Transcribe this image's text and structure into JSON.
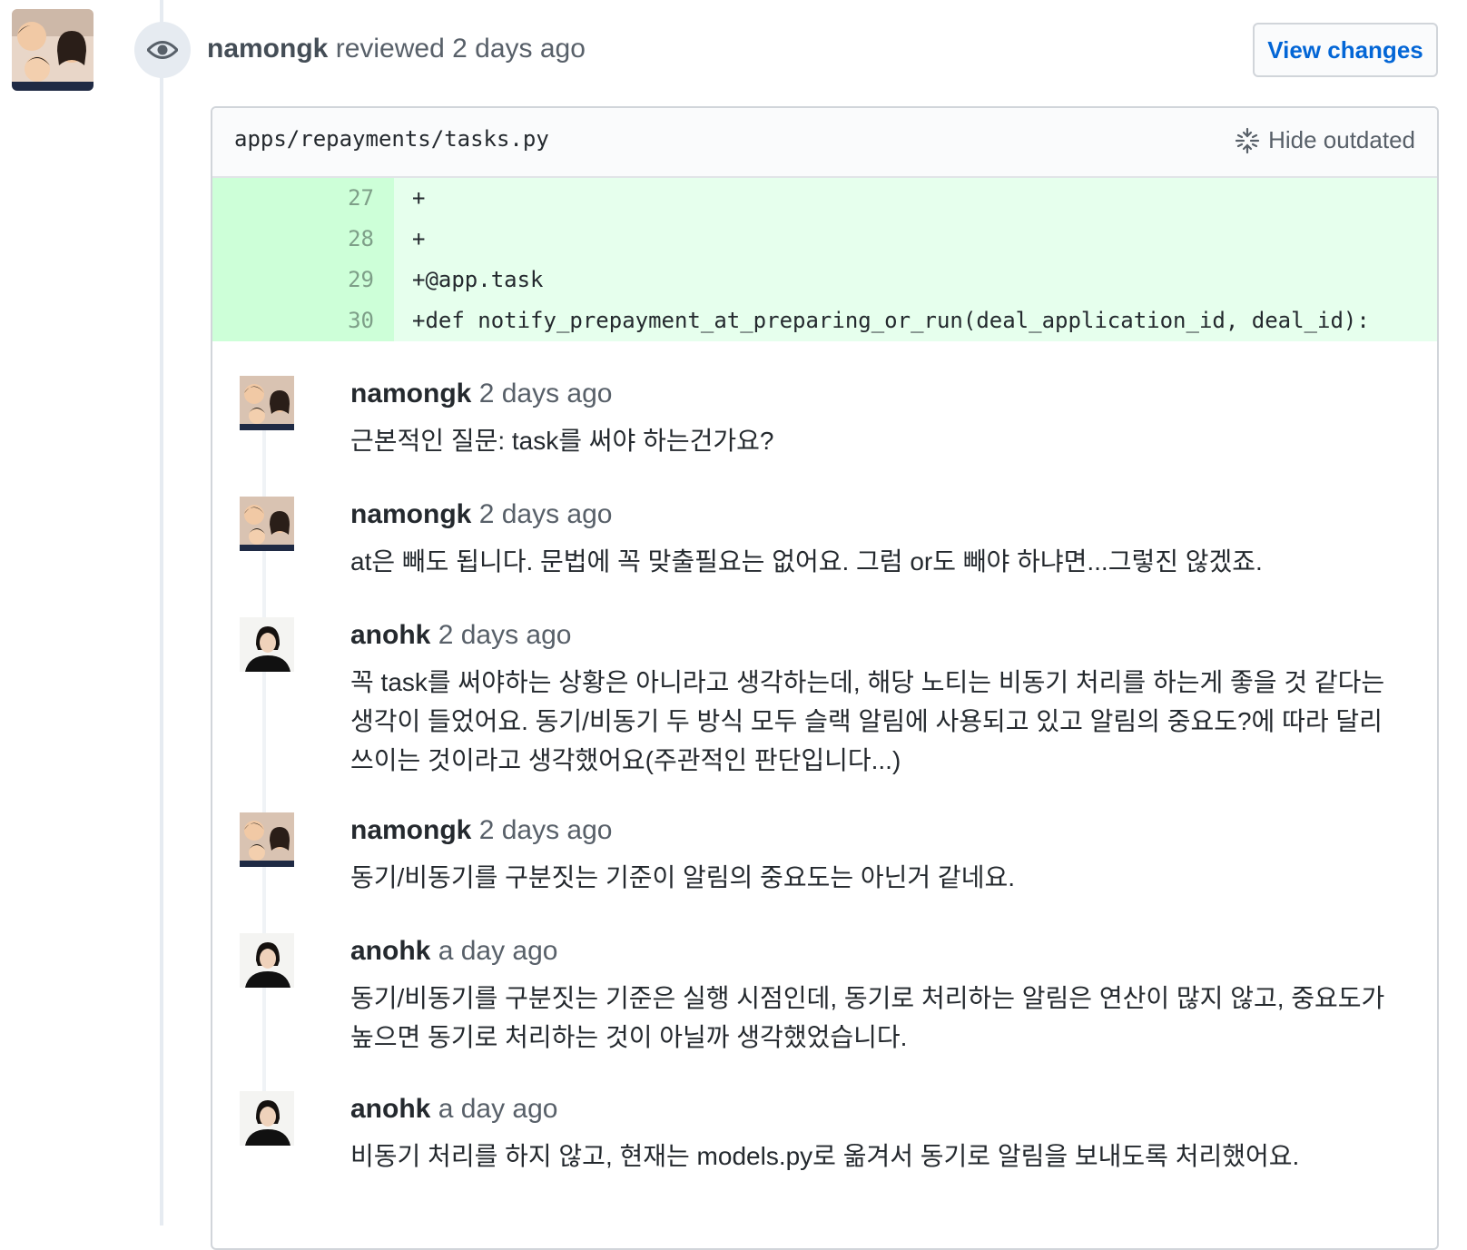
{
  "review": {
    "author": "namongk",
    "action": "reviewed",
    "time": "2 days ago",
    "view_changes_label": "View changes"
  },
  "file": {
    "path": "apps/repayments/tasks.py",
    "hide_outdated_label": "Hide outdated",
    "lines": [
      {
        "num": "27",
        "code": "+"
      },
      {
        "num": "28",
        "code": "+"
      },
      {
        "num": "29",
        "code": "+@app.task"
      },
      {
        "num": "30",
        "code": "+def notify_prepayment_at_preparing_or_run(deal_application_id, deal_id):"
      }
    ]
  },
  "comments": [
    {
      "author": "namongk",
      "time": "2 days ago",
      "body": "근본적인 질문: task를 써야 하는건가요?"
    },
    {
      "author": "namongk",
      "time": "2 days ago",
      "body": "at은 빼도 됩니다. 문법에 꼭 맞출필요는 없어요. 그럼 or도 빼야 하냐면...그렇진 않겠죠."
    },
    {
      "author": "anohk",
      "time": "2 days ago",
      "body": "꼭 task를 써야하는 상황은 아니라고 생각하는데, 해당 노티는 비동기 처리를 하는게 좋을 것 같다는 생각이 들었어요. 동기/비동기 두 방식 모두 슬랙 알림에 사용되고 있고 알림의 중요도?에 따라 달리 쓰이는 것이라고 생각했어요(주관적인 판단입니다...)"
    },
    {
      "author": "namongk",
      "time": "2 days ago",
      "body": "동기/비동기를 구분짓는 기준이 알림의 중요도는 아닌거 같네요."
    },
    {
      "author": "anohk",
      "time": "a day ago",
      "body": "동기/비동기를 구분짓는 기준은 실행 시점인데, 동기로 처리하는 알림은 연산이 많지 않고, 중요도가 높으면 동기로 처리하는 것이 아닐까 생각했었습니다."
    },
    {
      "author": "anohk",
      "time": "a day ago",
      "body": "비동기 처리를 하지 않고, 현재는 models.py로 옮겨서 동기로 알림을 보내도록 처리했어요."
    }
  ]
}
